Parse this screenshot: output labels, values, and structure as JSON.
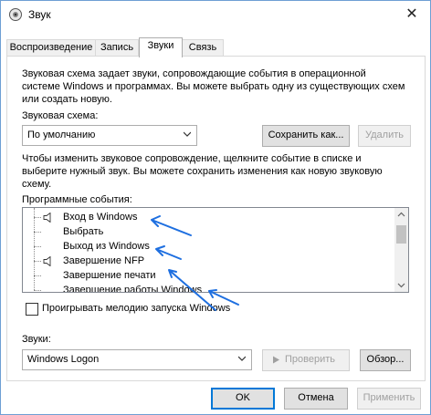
{
  "window": {
    "title": "Звук"
  },
  "tabs": [
    {
      "label": "Воспроизведение"
    },
    {
      "label": "Запись"
    },
    {
      "label": "Звуки"
    },
    {
      "label": "Связь"
    }
  ],
  "scheme": {
    "description": "Звуковая схема задает звуки, сопровождающие события в операционной системе Windows и программах. Вы можете выбрать одну из существующих схем или создать новую.",
    "label": "Звуковая схема:",
    "selected": "По умолчанию",
    "save_label": "Сохранить как...",
    "delete_label": "Удалить"
  },
  "events": {
    "description": "Чтобы изменить звуковое сопровождение, щелкните событие в списке и выберите нужный звук. Вы можете сохранить изменения как новую звуковую схему.",
    "label": "Программные события:",
    "items": [
      {
        "label": "Вход в Windows",
        "has_sound": true,
        "selected": true
      },
      {
        "label": "Выбрать",
        "has_sound": false,
        "selected": false
      },
      {
        "label": "Выход из Windows",
        "has_sound": false,
        "selected": false
      },
      {
        "label": "Завершение NFP",
        "has_sound": true,
        "selected": false
      },
      {
        "label": "Завершение печати",
        "has_sound": false,
        "selected": false
      },
      {
        "label": "Завершение работы Windows",
        "has_sound": false,
        "selected": false
      }
    ]
  },
  "startup_checkbox": {
    "label": "Проигрывать мелодию запуска Windows",
    "checked": false
  },
  "sounds": {
    "label": "Звуки:",
    "selected": "Windows Logon",
    "test_label": "Проверить",
    "browse_label": "Обзор..."
  },
  "footer": {
    "ok_label": "OK",
    "cancel_label": "Отмена",
    "apply_label": "Применить"
  },
  "colors": {
    "annotation_arrow": "#1e6fe0",
    "focus_border": "#0078d7",
    "window_border": "#6e9fd4"
  }
}
